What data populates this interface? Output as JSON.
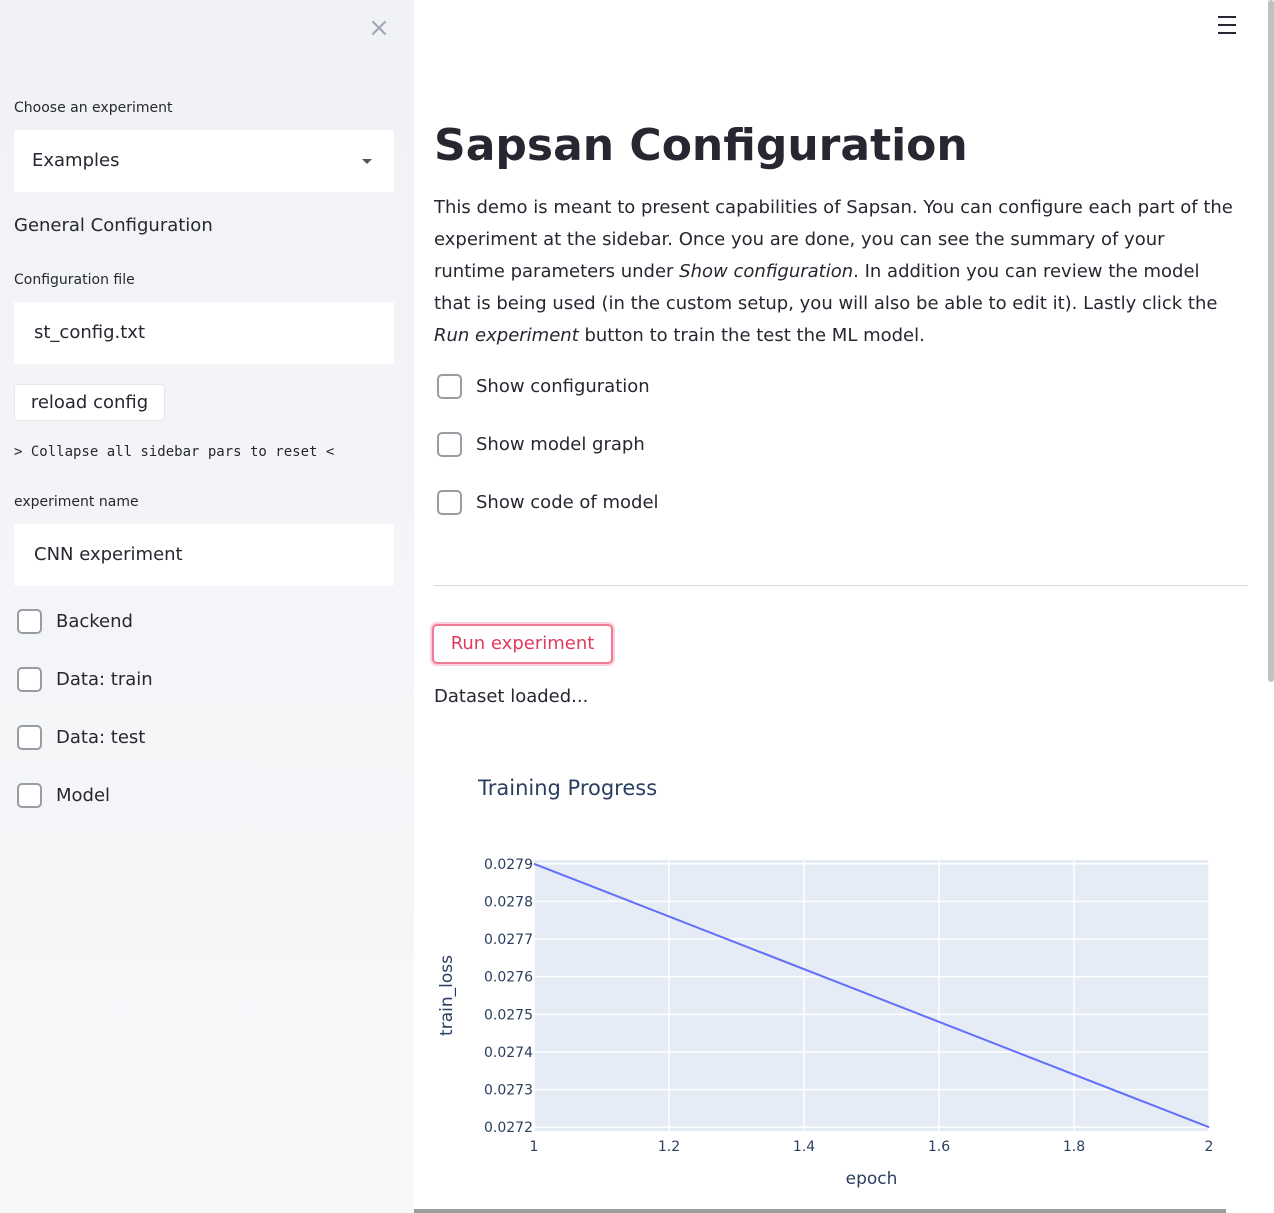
{
  "sidebar": {
    "close_icon": "×",
    "experiment_label": "Choose an experiment",
    "experiment_value": "Examples",
    "general_heading": "General Configuration",
    "config_file_label": "Configuration file",
    "config_file_value": "st_config.txt",
    "reload_label": "reload config",
    "collapse_note": "> Collapse all sidebar pars to reset <",
    "experiment_name_label": "experiment name",
    "experiment_name_value": "CNN experiment",
    "checkboxes": [
      {
        "label": "Backend",
        "checked": false
      },
      {
        "label": "Data: train",
        "checked": false
      },
      {
        "label": "Data: test",
        "checked": false
      },
      {
        "label": "Model",
        "checked": false
      }
    ]
  },
  "main": {
    "title": "Sapsan Configuration",
    "intro": {
      "part1": "This demo is meant to present capabilities of Sapsan. You can configure each part of the experiment at the sidebar. Once you are done, you can see the summary of your runtime parameters under ",
      "em1": "Show configuration",
      "part2": ". In addition you can review the model that is being used (in the custom setup, you will also be able to edit it). Lastly click the ",
      "em2": "Run experiment",
      "part3": " button to train the test the ML model."
    },
    "checkboxes": [
      {
        "label": "Show configuration",
        "checked": false
      },
      {
        "label": "Show model graph",
        "checked": false
      },
      {
        "label": "Show code of model",
        "checked": false
      }
    ],
    "run_label": "Run experiment",
    "status": "Dataset loaded...",
    "accent_color": "#e03b5e"
  },
  "chart_data": {
    "type": "line",
    "title": "Training Progress",
    "xlabel": "epoch",
    "ylabel": "train_loss",
    "xlim": [
      1,
      2
    ],
    "ylim": [
      0.02719,
      0.02791
    ],
    "xticks": [
      1,
      1.2,
      1.4,
      1.6,
      1.8,
      2
    ],
    "xtick_labels": [
      "1",
      "1.2",
      "1.4",
      "1.6",
      "1.8",
      "2"
    ],
    "yticks": [
      0.0272,
      0.0273,
      0.0274,
      0.0275,
      0.0276,
      0.0277,
      0.0278,
      0.0279
    ],
    "ytick_labels": [
      "0.0272",
      "0.0273",
      "0.0274",
      "0.0275",
      "0.0276",
      "0.0277",
      "0.0278",
      "0.0279"
    ],
    "series": [
      {
        "x": [
          1,
          2
        ],
        "y": [
          0.0279,
          0.0272
        ],
        "color": "#636efa"
      }
    ],
    "grid": true
  }
}
